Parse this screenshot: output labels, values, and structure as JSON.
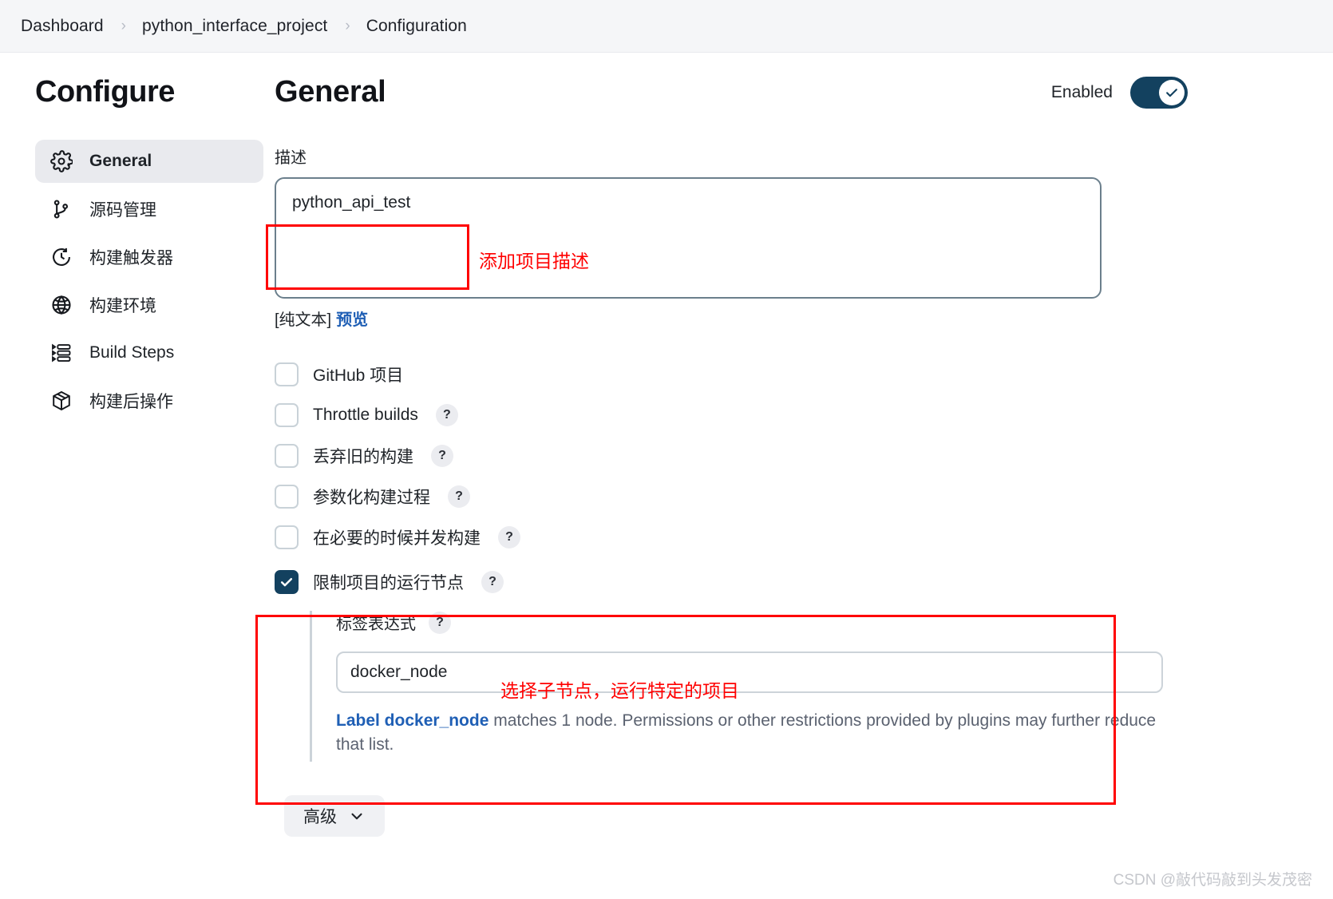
{
  "breadcrumb": {
    "items": [
      "Dashboard",
      "python_interface_project",
      "Configuration"
    ],
    "separator": "›"
  },
  "sidebar": {
    "title": "Configure",
    "items": [
      {
        "label": "General",
        "icon": "gear-icon",
        "active": true
      },
      {
        "label": "源码管理",
        "icon": "branch-icon",
        "active": false
      },
      {
        "label": "构建触发器",
        "icon": "clock-icon",
        "active": false
      },
      {
        "label": "构建环境",
        "icon": "globe-icon",
        "active": false
      },
      {
        "label": "Build Steps",
        "icon": "list-steps-icon",
        "active": false
      },
      {
        "label": "构建后操作",
        "icon": "package-icon",
        "active": false
      }
    ]
  },
  "header": {
    "title": "General",
    "enabled_label": "Enabled",
    "enabled_state": true
  },
  "description": {
    "label": "描述",
    "value": "python_api_test",
    "placeholder": "",
    "footer_plain": "[纯文本]",
    "footer_preview": "预览"
  },
  "checkboxes": [
    {
      "label": "GitHub 项目",
      "checked": false,
      "help": false
    },
    {
      "label": "Throttle builds",
      "checked": false,
      "help": true
    },
    {
      "label": "丢弃旧的构建",
      "checked": false,
      "help": true
    },
    {
      "label": "参数化构建过程",
      "checked": false,
      "help": true
    },
    {
      "label": "在必要的时候并发构建",
      "checked": false,
      "help": true
    }
  ],
  "restrict": {
    "label": "限制项目的运行节点",
    "checked": true,
    "help": true,
    "sub_label": "标签表达式",
    "sub_help": true,
    "input_value": "docker_node",
    "message_link": "Label docker_node",
    "message_rest": " matches 1 node. Permissions or other restrictions provided by plugins may further reduce that list."
  },
  "advanced": {
    "label": "高级",
    "chevron": "chevron-down-icon"
  },
  "annotations": [
    {
      "text": "添加项目描述",
      "id": "annot-description"
    },
    {
      "text": "选择子节点，运行特定的项目",
      "id": "annot-node"
    }
  ],
  "watermark": "CSDN @敲代码敲到头发茂密",
  "colors": {
    "accent_navy": "#13415f",
    "link_blue": "#1f5fb5",
    "annotation_red": "#ff0000",
    "sidebar_active_bg": "#e9eaee"
  }
}
